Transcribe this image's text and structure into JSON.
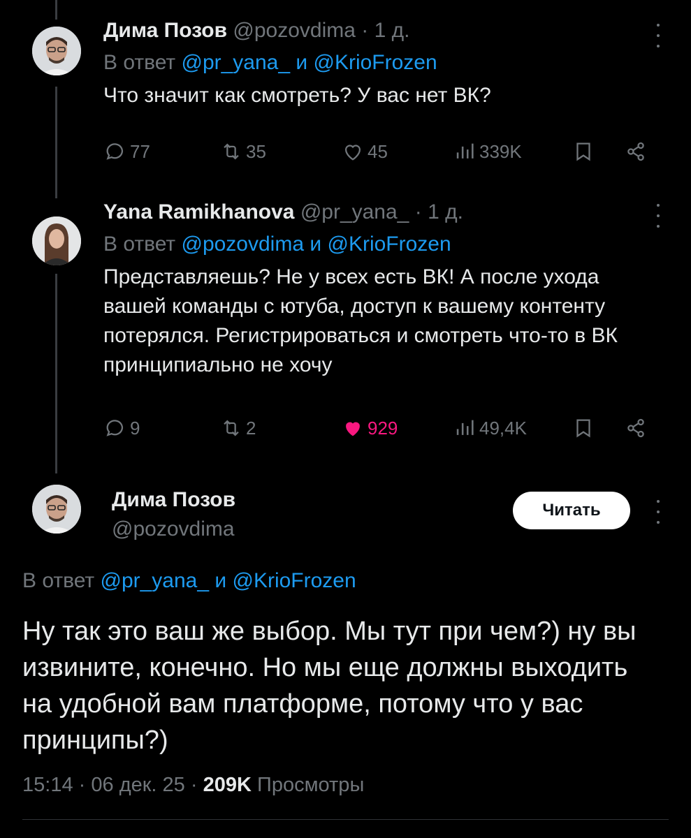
{
  "tweets": [
    {
      "author": "Дима Позов",
      "handle": "@pozovdima",
      "time_sep": "·",
      "time": "1 д.",
      "reply_prefix": "В ответ",
      "reply_user1": "@pr_yana_",
      "reply_and": "и",
      "reply_user2": "@KrioFrozen",
      "text": "Что значит как смотреть? У вас нет ВК?",
      "replies": "77",
      "retweets": "35",
      "likes": "45",
      "views": "339K"
    },
    {
      "author": "Yana Ramikhanova",
      "handle": "@pr_yana_",
      "time_sep": "·",
      "time": "1 д.",
      "reply_prefix": "В ответ",
      "reply_user1": "@pozovdima",
      "reply_and": "и",
      "reply_user2": "@KrioFrozen",
      "text": "Представляешь? Не у всех есть ВК! А после ухода вашей команды с ютуба, доступ к вашему контенту потерялся. Регистрироваться и смотреть что-то в ВК принципиально не хочу",
      "replies": "9",
      "retweets": "2",
      "likes": "929",
      "views": "49,4K",
      "liked": true
    }
  ],
  "main": {
    "author": "Дима Позов",
    "handle": "@pozovdima",
    "follow_label": "Читать",
    "reply_prefix": "В ответ",
    "reply_user1": "@pr_yana_",
    "reply_and": "и",
    "reply_user2": "@KrioFrozen",
    "text": "Ну так это ваш же выбор. Мы тут при чем?) ну вы извините, конечно. Но мы еще должны выходить на удобной вам платформе, потому что у вас принципы?)",
    "time": "15:14",
    "sep": "·",
    "date": "06 дек. 25",
    "views_count": "209K",
    "views_label": "Просмотры"
  },
  "colors": {
    "background": "#000000",
    "text": "#e7e9ea",
    "muted": "#71767b",
    "link": "#1d9bf0",
    "like_active": "#f91880"
  },
  "icons": [
    "reply-icon",
    "retweet-icon",
    "like-icon",
    "views-icon",
    "bookmark-icon",
    "share-icon",
    "more-icon"
  ]
}
